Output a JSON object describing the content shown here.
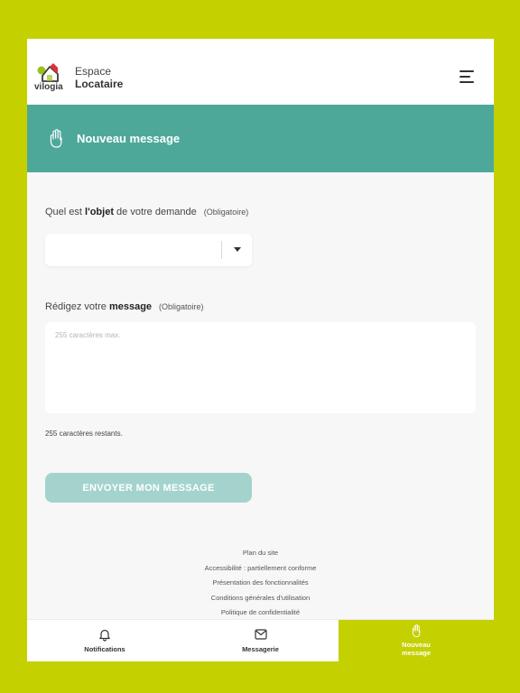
{
  "header": {
    "brand_word": "vilogia",
    "title_line1": "Espace",
    "title_line2": "Locataire"
  },
  "hero": {
    "title": "Nouveau message",
    "icon": "hand-icon"
  },
  "form": {
    "subject": {
      "label_pre": "Quel est ",
      "label_bold": "l'objet",
      "label_post": " de votre demande",
      "required": "(Obligatoire)",
      "selected_value": ""
    },
    "message": {
      "label_pre": "Rédigez votre ",
      "label_bold": "message",
      "required": "(Obligatoire)",
      "placeholder": "255 caractères max.",
      "value": ""
    },
    "counter": "255 caractères restants.",
    "submit_label": "ENVOYER MON MESSAGE"
  },
  "footer": {
    "links": [
      "Plan du site",
      "Accessibilité : partiellement conforme",
      "Présentation des fonctionnalités",
      "Conditions générales d'utilisation",
      "Politique de confidentialité"
    ]
  },
  "tabs": {
    "notifications": "Notifications",
    "messaging": "Messagerie",
    "new_line1": "Nouveau",
    "new_line2": "message"
  },
  "colors": {
    "background": "#c4d000",
    "hero": "#4ea89a",
    "button_disabled": "#a4d3cd",
    "active_tab": "#c4d000"
  }
}
